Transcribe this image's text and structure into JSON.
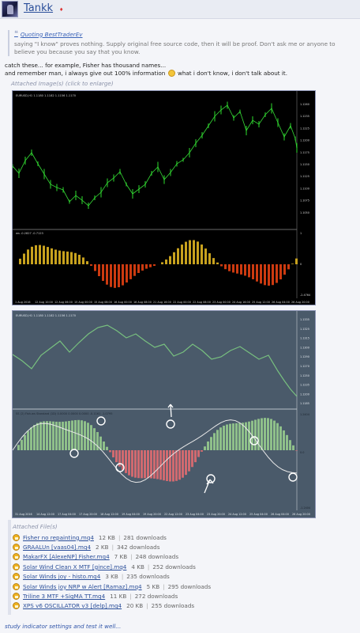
{
  "user": {
    "name": "Tankk",
    "badge": "♦"
  },
  "quote": {
    "author_label": "Quoting BestTraderEv",
    "text": "saying \"I know\" proves nothing. Supply original free source code, then it will be proof. Don't ask me or anyone to believe you because you say that you know."
  },
  "message": {
    "line1": "catch these... for example, Fisher has thousand names...",
    "line2_before": "and remember man, i always give out 100% information",
    "line2_after": "what i don't know, i don't talk about it."
  },
  "attachments_title": "Attached Image(s) (click to enlarge)",
  "chart1": {
    "price_title": "EURUSD,H1  1.1180 1.1182 1.1156 1.1170",
    "price_ticks": [
      "1.1260",
      "1.1235",
      "1.1225",
      "1.1200",
      "1.1175",
      "1.1150",
      "1.1125",
      "1.1100",
      "1.1075",
      "1.1050"
    ],
    "indicator_title": "ws -0.2827 -0.7123",
    "indicator_ticks": [
      "1",
      "0",
      "-2.4764"
    ],
    "time_labels": [
      "1 Aug 2016",
      "12 Aug 10:00",
      "12 Aug 06:00",
      "15 Aug 00:00",
      "15 Aug 08:00",
      "16 Aug 00:00",
      "16 Aug 08:00",
      "21 Aug 16:00",
      "22 Aug 00:00",
      "22 Aug 08:00",
      "23 Aug 00:00",
      "24 Aug 16:00",
      "25 Aug 12:00",
      "26 Aug 04:00",
      "26 Aug 20:00"
    ]
  },
  "chart2": {
    "price_title": "EURUSD,H1  1.1180 1.1182 1.1156 1.1170",
    "price_ticks": [
      "1.1335",
      "1.1325",
      "1.1315",
      "1.1300",
      "1.1290",
      "1.1270",
      "1.1250",
      "1.1235",
      "1.1200",
      "1.1185"
    ],
    "indicator_title": "SS (2) Fish.ws Standard (1D) 0.0000 0.0000 0.0000 -0.1161 -1.0795",
    "indicator_ticks": [
      "1.2404",
      "0.0",
      "-1.2404"
    ],
    "time_labels": [
      "31 Aug 2016",
      "14 Aug 12:00",
      "17 Aug 04:00",
      "17 Aug 20:00",
      "18 Aug 12:00",
      "19 Aug 04:00",
      "19 Aug 20:00",
      "22 Aug 12:00",
      "23 Aug 04:00",
      "23 Aug 20:00",
      "24 Aug 12:00",
      "25 Aug 04:00",
      "26 Aug 04:00",
      "26 Aug 20:00"
    ]
  },
  "files_title": "Attached File(s)",
  "files": [
    {
      "name": "Fisher no repainting.mq4",
      "size": "12 KB",
      "downloads": "281 downloads"
    },
    {
      "name": "GRAALUn [vaas04].mq4",
      "size": "2 KB",
      "downloads": "342 downloads"
    },
    {
      "name": "MakarFX [AlexeNP] Fisher.mq4",
      "size": "7 KB",
      "downloads": "248 downloads"
    },
    {
      "name": "Solar Wind Clean X MTF [gince].mq4",
      "size": "4 KB",
      "downloads": "252 downloads"
    },
    {
      "name": "Solar Winds joy - histo.mq4",
      "size": "3 KB",
      "downloads": "235 downloads"
    },
    {
      "name": "Solar Winds joy NRP w Alert [Ramaz].mq4",
      "size": "5 KB",
      "downloads": "295 downloads"
    },
    {
      "name": "Triline 3 MTF +SigMA TT.mq4",
      "size": "11 KB",
      "downloads": "272 downloads"
    },
    {
      "name": "XPS v6 OSCILLATOR v3 [delp].mq4",
      "size": "20 KB",
      "downloads": "255 downloads"
    }
  ],
  "footer": "study indicator settings and test it well...",
  "colors": {
    "link": "#2b4f9a",
    "bull": "#22aa22",
    "bear": "#cc2222",
    "osc_bull": "#c8a21e",
    "osc_bear": "#cc3a10",
    "chart2_bull": "#8fc08a",
    "chart2_bear": "#d06a70"
  }
}
